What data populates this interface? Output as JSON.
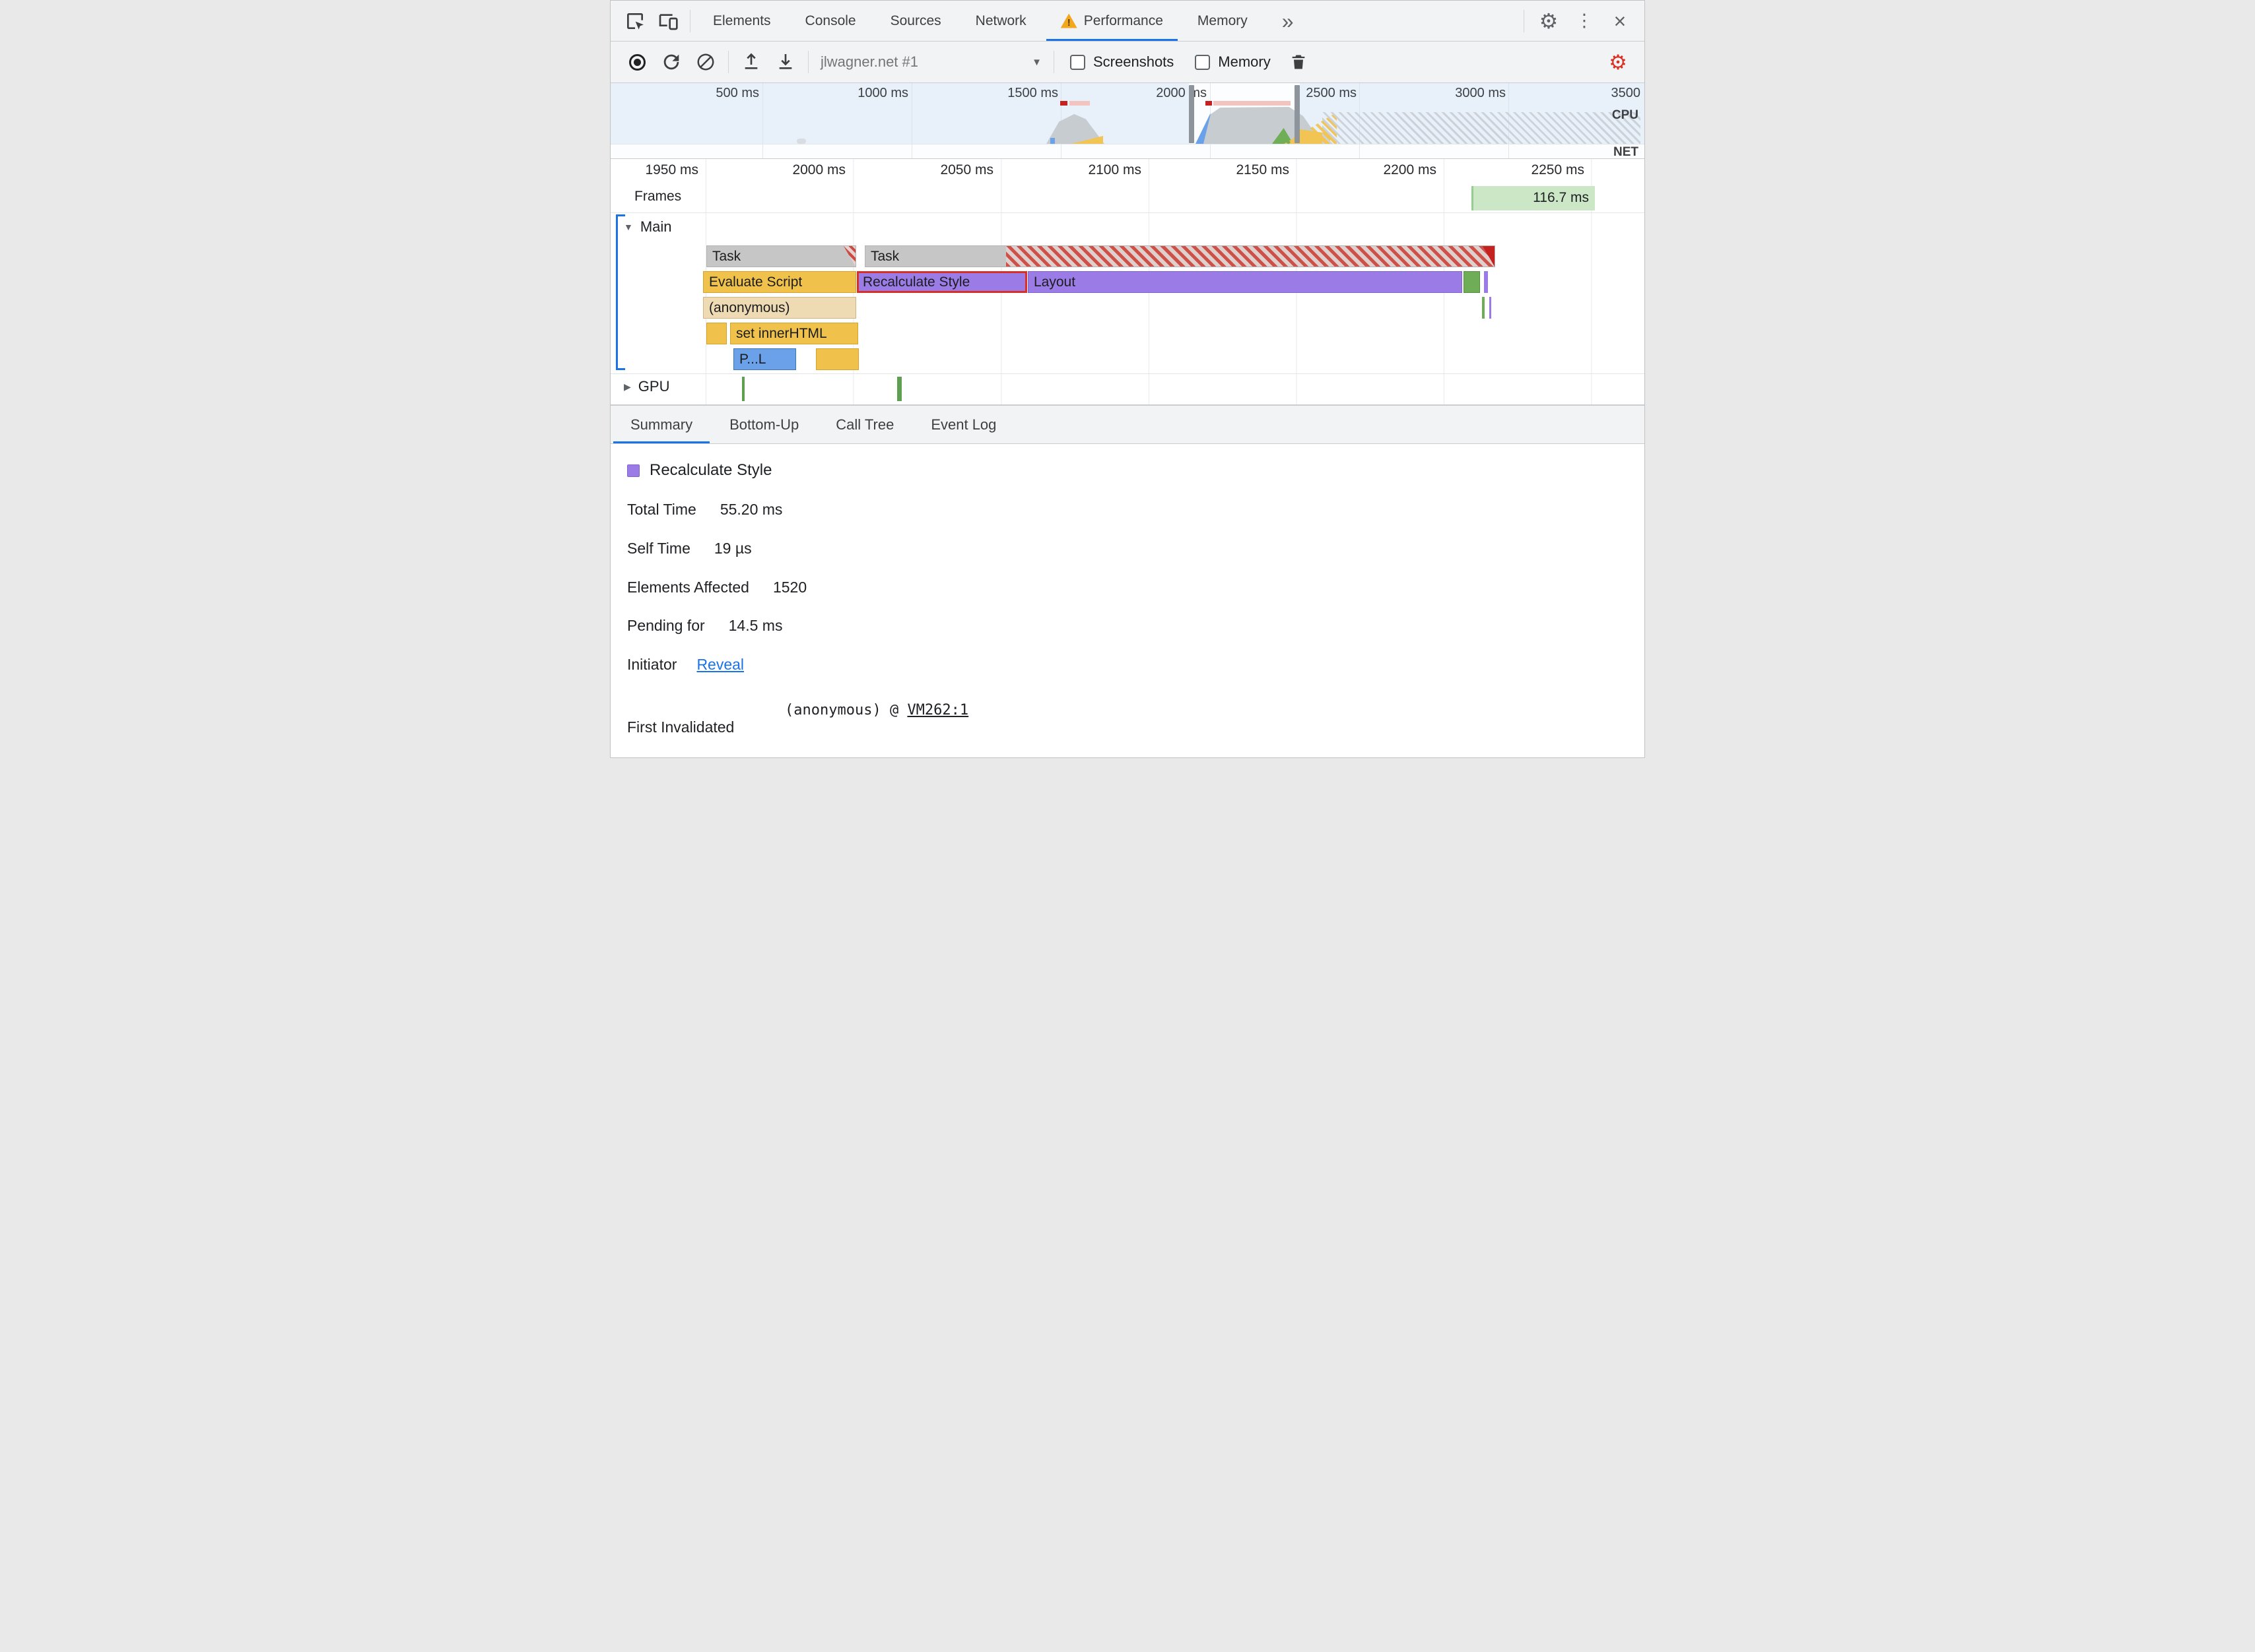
{
  "devtools": {
    "tabs": [
      "Elements",
      "Console",
      "Sources",
      "Network",
      "Performance",
      "Memory"
    ],
    "active_tab": "Performance",
    "icons": {
      "overflow": "»",
      "gear": "⚙",
      "dots": "⋮",
      "close": "×",
      "dropdown": "▼",
      "collapse_open": "▼",
      "collapse_closed": "▶"
    }
  },
  "toolbar": {
    "profile_label": "jlwagner.net #1",
    "screenshots_label": "Screenshots",
    "memory_label": "Memory"
  },
  "overview": {
    "ticks": [
      "500 ms",
      "1000 ms",
      "1500 ms",
      "2000 ms",
      "2500 ms",
      "3000 ms",
      "3500"
    ],
    "cpu_label": "CPU",
    "net_label": "NET"
  },
  "timeline": {
    "ticks": [
      "1950 ms",
      "2000 ms",
      "2050 ms",
      "2100 ms",
      "2150 ms",
      "2200 ms",
      "2250 ms"
    ],
    "frames_label": "Frames",
    "frame_duration": "116.7 ms",
    "main_label": "Main",
    "gpu_label": "GPU",
    "events": {
      "task_a": "Task",
      "task_b": "Task",
      "evaluate_script": "Evaluate Script",
      "recalculate_style": "Recalculate Style",
      "layout": "Layout",
      "anonymous": "(anonymous)",
      "set_inner_html": "set innerHTML",
      "parse_truncated": "P...L"
    }
  },
  "bottom_tabs": [
    "Summary",
    "Bottom-Up",
    "Call Tree",
    "Event Log"
  ],
  "summary": {
    "legend_title": "Recalculate Style",
    "rows": [
      {
        "label": "Total Time",
        "value": "55.20 ms"
      },
      {
        "label": "Self Time",
        "value": "19 µs"
      },
      {
        "label": "Elements Affected",
        "value": "1520"
      },
      {
        "label": "Pending for",
        "value": "14.5 ms"
      }
    ],
    "initiator_label": "Initiator",
    "initiator_link": "Reveal",
    "first_invalidated_label": "First Invalidated",
    "first_invalidated_code": "(anonymous) @ ",
    "first_invalidated_link": "VM262:1"
  },
  "colors": {
    "accent": "#1a73e8",
    "selection_red": "#d93025",
    "scripting_yellow": "#f0c24b",
    "rendering_purple": "#9b7ce6",
    "painting_green": "#6fae57",
    "task_gray": "#c6c6c6",
    "frame_green": "#cbe7c6"
  }
}
